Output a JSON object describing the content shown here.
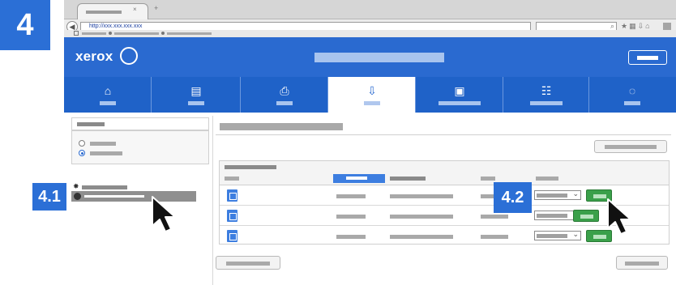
{
  "step": {
    "number": "4"
  },
  "browser": {
    "url": "http://xxx.xxx.xxx.xxx"
  },
  "header": {
    "brand": "xerox",
    "brand_color": "#2a6ad0"
  },
  "nav": {
    "tabs": [
      {
        "icon": "home-icon",
        "glyph": "⌂"
      },
      {
        "icon": "jobs-icon",
        "glyph": "▤"
      },
      {
        "icon": "print-icon",
        "glyph": "⎙"
      },
      {
        "icon": "scan-icon",
        "glyph": "⇩",
        "active": true
      },
      {
        "icon": "address-book-icon",
        "glyph": "▣"
      },
      {
        "icon": "properties-icon",
        "glyph": "☷"
      },
      {
        "icon": "support-icon",
        "glyph": "◌"
      }
    ]
  },
  "callouts": {
    "left": "4.1",
    "right": "4.2"
  },
  "colors": {
    "accent": "#2b6fd6",
    "action_green": "#3aa04a"
  }
}
